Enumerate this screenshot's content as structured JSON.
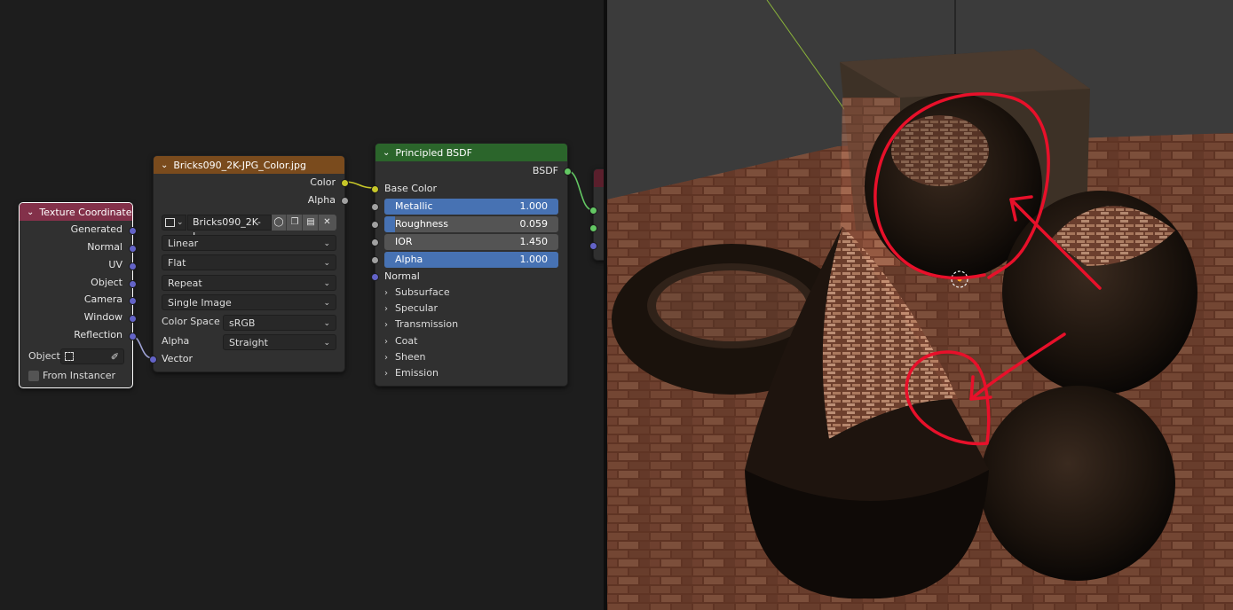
{
  "nodes": {
    "texture_coordinate": {
      "title": "Texture Coordinate",
      "outputs": [
        "Generated",
        "Normal",
        "UV",
        "Object",
        "Camera",
        "Window",
        "Reflection"
      ],
      "object_label": "Object:",
      "from_instancer": "From Instancer"
    },
    "image_texture": {
      "title": "Bricks090_2K-JPG_Color.jpg",
      "outputs": {
        "color": "Color",
        "alpha": "Alpha"
      },
      "image_name": "Bricks090_2K-J...",
      "interpolation": "Linear",
      "projection": "Flat",
      "extension": "Repeat",
      "source": "Single Image",
      "color_space_label": "Color Space",
      "color_space": "sRGB",
      "alpha_label": "Alpha",
      "alpha_mode": "Straight",
      "input_vector": "Vector"
    },
    "principled_bsdf": {
      "title": "Principled BSDF",
      "output": "BSDF",
      "base_color": "Base Color",
      "sliders": [
        {
          "label": "Metallic",
          "value": "1.000",
          "fill": 1.0
        },
        {
          "label": "Roughness",
          "value": "0.059",
          "fill": 0.059
        },
        {
          "label": "IOR",
          "value": "1.450",
          "fill": 0.0
        },
        {
          "label": "Alpha",
          "value": "1.000",
          "fill": 1.0
        }
      ],
      "normal": "Normal",
      "panels": [
        "Subsurface",
        "Specular",
        "Transmission",
        "Coat",
        "Sheen",
        "Emission"
      ]
    }
  },
  "colors": {
    "texcoord_header": "#83314a",
    "image_header": "#7a4b1d",
    "bsdf_header": "#2b652b",
    "output_header": "#5a1f2c",
    "slider_fill": "#4772b3",
    "annotation": "#e8102a"
  }
}
